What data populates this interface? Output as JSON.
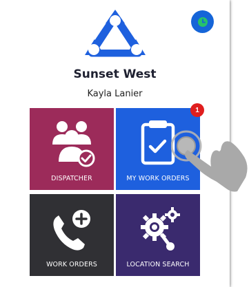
{
  "colors": {
    "brand": "#1e60de",
    "dispatcher_tile": "#9c2b5a",
    "my_work_orders_tile": "#1e60de",
    "work_orders_tile": "#303034",
    "location_search_tile": "#3a2a6e",
    "badge": "#e01e1e",
    "clock_badge": "#1565d8",
    "clock_icon": "#27c26b"
  },
  "header": {
    "status_icon": "clock-icon",
    "logo_icon": "triangle-logo-icon",
    "site_name": "Sunset West",
    "user_name": "Kayla Lanier"
  },
  "tiles": [
    {
      "label": "DISPATCHER",
      "icon": "users-check-icon"
    },
    {
      "label": "MY WORK ORDERS",
      "icon": "clipboard-check-icon",
      "badge": "1"
    },
    {
      "label": "WORK ORDERS",
      "icon": "phone-plus-icon"
    },
    {
      "label": "LOCATION SEARCH",
      "icon": "gear-search-icon"
    }
  ],
  "pointer": {
    "icon": "tap-hand-icon"
  }
}
